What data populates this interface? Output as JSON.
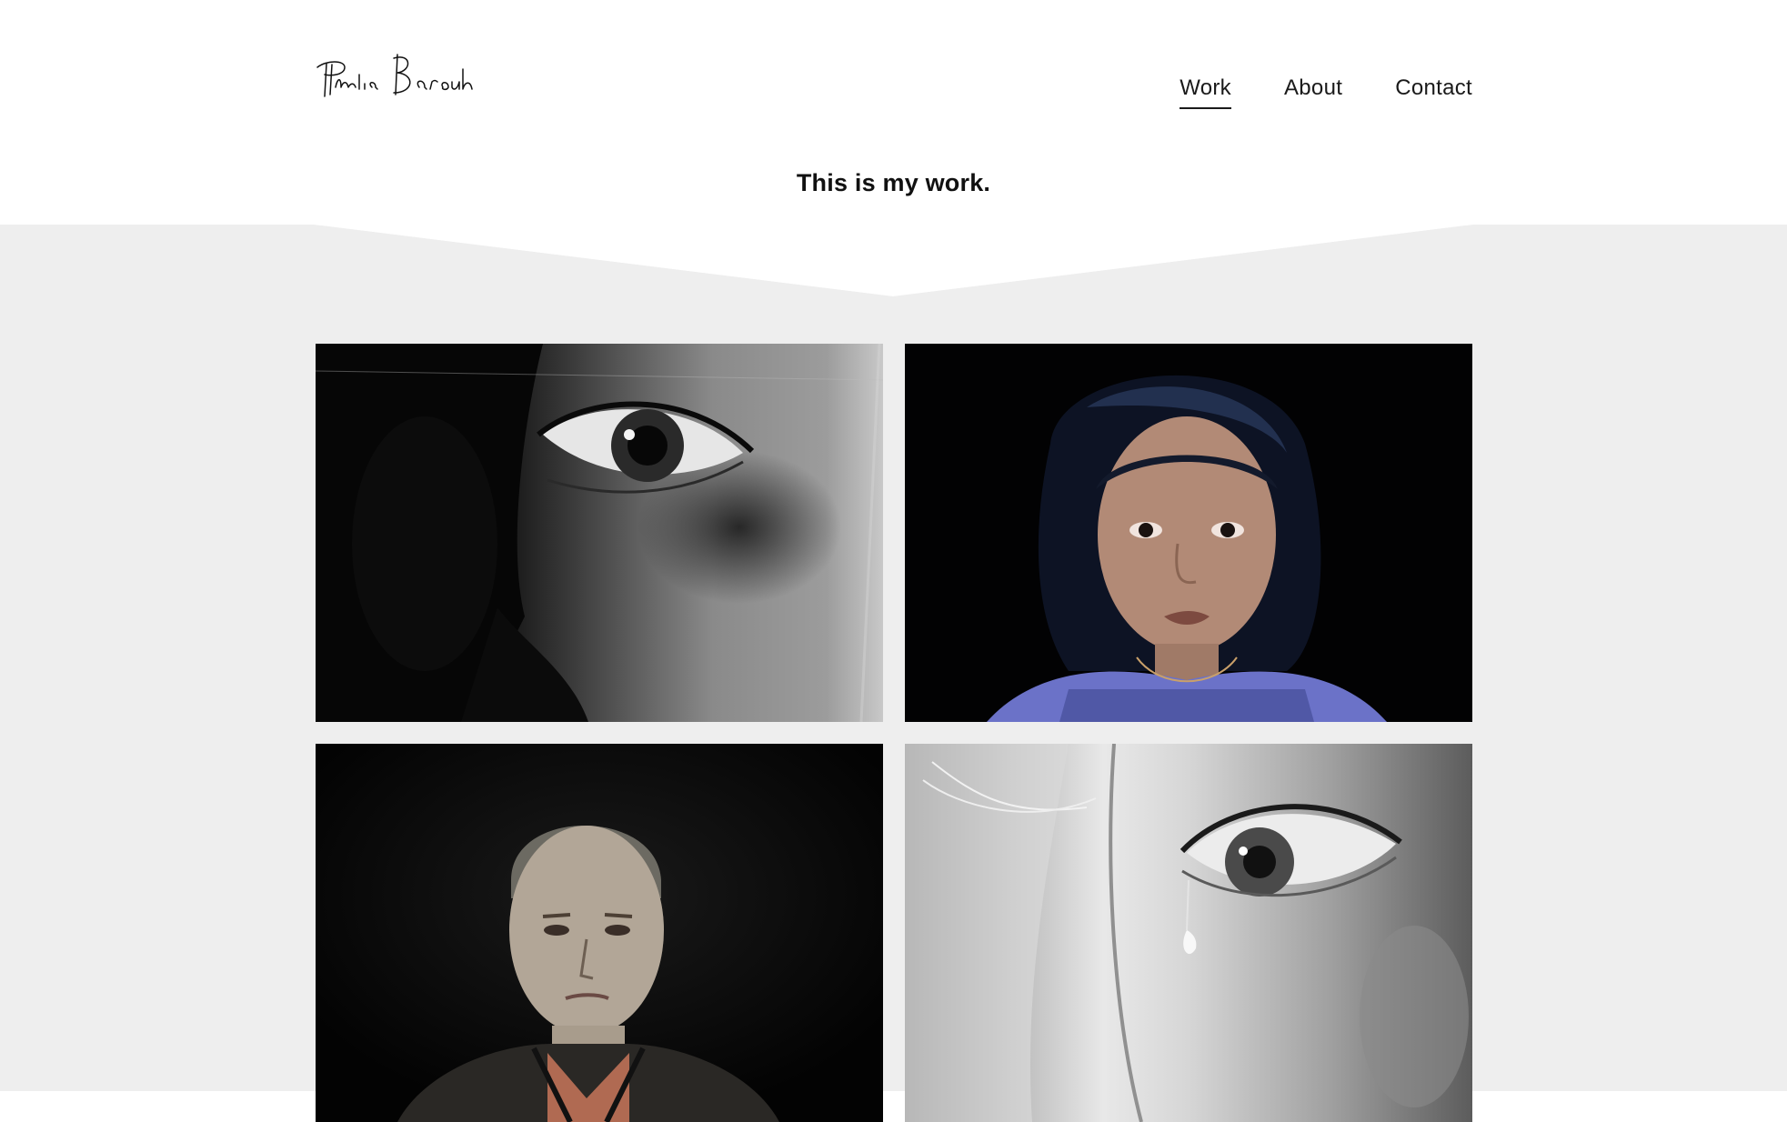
{
  "site": {
    "logo_text": "Phelia Barouh",
    "logo_icon": "signature-logo"
  },
  "nav": {
    "items": [
      {
        "label": "Work",
        "active": true
      },
      {
        "label": "About",
        "active": false
      },
      {
        "label": "Contact",
        "active": false
      }
    ]
  },
  "main": {
    "title": "This is my work."
  },
  "colors": {
    "background": "#ffffff",
    "band": "#eeeeee",
    "text": "#111111"
  },
  "gallery": {
    "tiles": [
      {
        "subject": "eye-closeup-bw-photo"
      },
      {
        "subject": "girl-portrait-photo"
      },
      {
        "subject": "man-portrait-photo"
      },
      {
        "subject": "tear-eye-bw-photo"
      }
    ]
  }
}
